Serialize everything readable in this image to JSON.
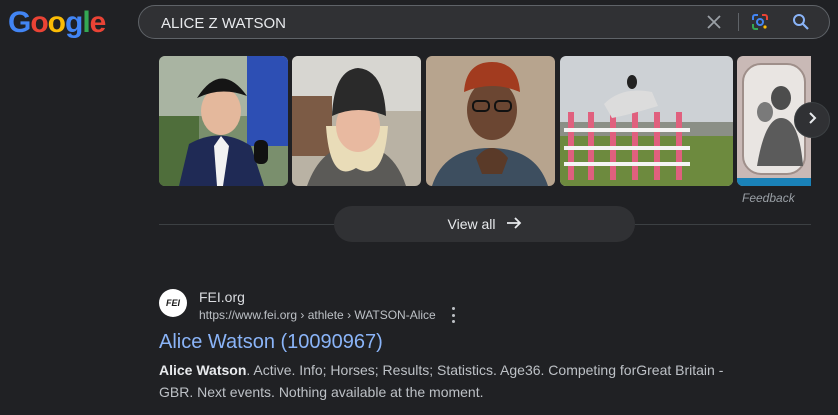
{
  "header": {
    "logo": {
      "letters": [
        "G",
        "o",
        "o",
        "g",
        "l",
        "e"
      ],
      "colors": [
        "#4285f4",
        "#ea4335",
        "#fbbc05",
        "#4285f4",
        "#34a853",
        "#ea4335"
      ]
    },
    "search": {
      "value": "ALICE Z WATSON"
    },
    "icons": {
      "clear": "close-icon",
      "lens": "google-lens-icon",
      "search": "search-icon"
    }
  },
  "images": {
    "thumbnails": [
      {
        "name": "rider-with-microphone"
      },
      {
        "name": "woman-in-beanie"
      },
      {
        "name": "woman-with-glasses"
      },
      {
        "name": "show-jumping-horse"
      },
      {
        "name": "framed-portrait"
      }
    ],
    "next_icon": "chevron-right-icon",
    "feedback": "Feedback",
    "view_all": "View all",
    "view_all_icon": "arrow-right-icon"
  },
  "result": {
    "favicon_text": "FEI",
    "site_name": "FEI.org",
    "url": "https://www.fei.org › athlete › WATSON-Alice",
    "title": "Alice Watson (10090967)",
    "snippet_bold": "Alice Watson",
    "snippet_line1": ". Active. Info; Horses; Results; Statistics. Age36. Competing forGreat Britain -",
    "snippet_line2": "GBR. Next events. Nothing available at the moment."
  }
}
